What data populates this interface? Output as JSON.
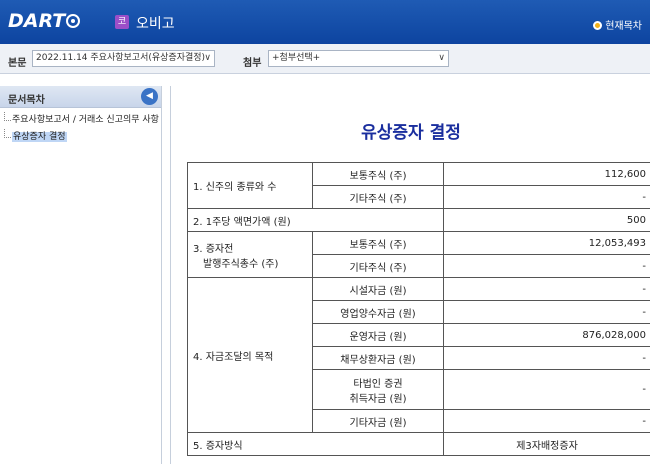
{
  "header": {
    "logo": "DART",
    "corp_badge": "코",
    "corp_name": "오비고",
    "toc_label": "현재목차"
  },
  "selectors": {
    "main_label": "본문",
    "main_value": "2022.11.14  주요사항보고서(유상증자결정)",
    "attach_label": "첨부",
    "attach_value": "+첨부선택+"
  },
  "sidebar": {
    "title": "문서목차",
    "items": [
      {
        "label": "주요사항보고서 / 거래소 신고의무 사항"
      },
      {
        "label": "유상증자 결정"
      }
    ]
  },
  "document": {
    "title": "유상증자 결정",
    "rows": {
      "r1_label": "1. 신주의 종류와 수",
      "r1a_sub": "보통주식 (주)",
      "r1a_val": "112,600",
      "r1b_sub": "기타주식 (주)",
      "r1b_val": "-",
      "r2_label": "2. 1주당 액면가액 (원)",
      "r2_val": "500",
      "r3_label_1": "3. 증자전",
      "r3_label_2": "발행주식총수 (주)",
      "r3a_sub": "보통주식 (주)",
      "r3a_val": "12,053,493",
      "r3b_sub": "기타주식 (주)",
      "r3b_val": "-",
      "r4_label": "4. 자금조달의 목적",
      "r4a_sub": "시설자금 (원)",
      "r4a_val": "-",
      "r4b_sub": "영업양수자금 (원)",
      "r4b_val": "-",
      "r4c_sub": "운영자금 (원)",
      "r4c_val": "876,028,000",
      "r4d_sub": "채무상환자금 (원)",
      "r4d_val": "-",
      "r4e_sub_1": "타법인 증권",
      "r4e_sub_2": "취득자금 (원)",
      "r4e_val": "-",
      "r4f_sub": "기타자금 (원)",
      "r4f_val": "-",
      "r5_label": "5. 증자방식",
      "r5_val": "제3자배정증자"
    }
  }
}
